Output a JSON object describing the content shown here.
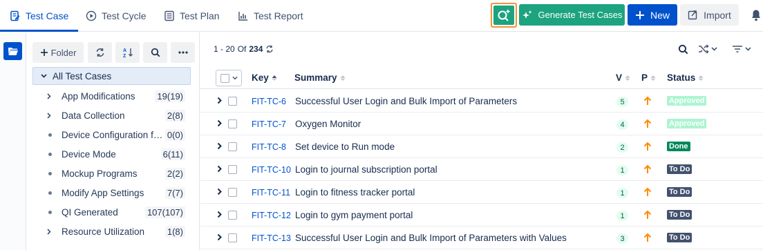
{
  "tabs": [
    {
      "label": "Test Case",
      "icon": "test-case-icon"
    },
    {
      "label": "Test Cycle",
      "icon": "test-cycle-icon"
    },
    {
      "label": "Test Plan",
      "icon": "test-plan-icon"
    },
    {
      "label": "Test Report",
      "icon": "test-report-icon"
    }
  ],
  "actions": {
    "generate_label": "Generate Test Cases",
    "new_label": "New",
    "import_label": "Import"
  },
  "folder_toolbar": {
    "folder_label": "Folder"
  },
  "tree": {
    "root_label": "All Test Cases",
    "items": [
      {
        "name": "App Modifications",
        "count": "19(19)",
        "type": "expandable"
      },
      {
        "name": "Data Collection",
        "count": "2(8)",
        "type": "expandable"
      },
      {
        "name": "Device Configuration fo...",
        "count": "0(0)",
        "type": "leaf"
      },
      {
        "name": "Device Mode",
        "count": "6(11)",
        "type": "leaf"
      },
      {
        "name": "Mockup Programs",
        "count": "2(2)",
        "type": "leaf"
      },
      {
        "name": "Modify App Settings",
        "count": "7(7)",
        "type": "leaf"
      },
      {
        "name": "QI Generated",
        "count": "107(107)",
        "type": "leaf"
      },
      {
        "name": "Resource Utilization",
        "count": "1(8)",
        "type": "expandable"
      }
    ]
  },
  "pager": {
    "range": "1 - 20",
    "of_label": "Of",
    "total": "234"
  },
  "table": {
    "headers": {
      "key": "Key",
      "summary": "Summary",
      "version": "V",
      "priority": "P",
      "status": "Status"
    },
    "rows": [
      {
        "key": "FIT-TC-6",
        "summary": "Successful User Login and Bulk Import of Parameters",
        "version": "5",
        "status": "Approved"
      },
      {
        "key": "FIT-TC-7",
        "summary": "Oxygen Monitor",
        "version": "4",
        "status": "Approved"
      },
      {
        "key": "FIT-TC-8",
        "summary": "Set device to Run mode",
        "version": "2",
        "status": "Done"
      },
      {
        "key": "FIT-TC-10",
        "summary": "Login to journal subscription portal",
        "version": "1",
        "status": "To Do"
      },
      {
        "key": "FIT-TC-11",
        "summary": "Login to fitness tracker portal",
        "version": "1",
        "status": "To Do"
      },
      {
        "key": "FIT-TC-12",
        "summary": "Login to gym payment portal",
        "version": "1",
        "status": "To Do"
      },
      {
        "key": "FIT-TC-13",
        "summary": "Successful User Login and Bulk Import of Parameters with Values",
        "version": "3",
        "status": "To Do"
      }
    ]
  },
  "colors": {
    "accent": "#0052cc",
    "ai_green": "#1da37f",
    "highlight_border": "#f79232",
    "status_approved": "#abf5d1",
    "status_done": "#00875a",
    "status_todo": "#42526e",
    "priority_high": "#ff8b00"
  }
}
